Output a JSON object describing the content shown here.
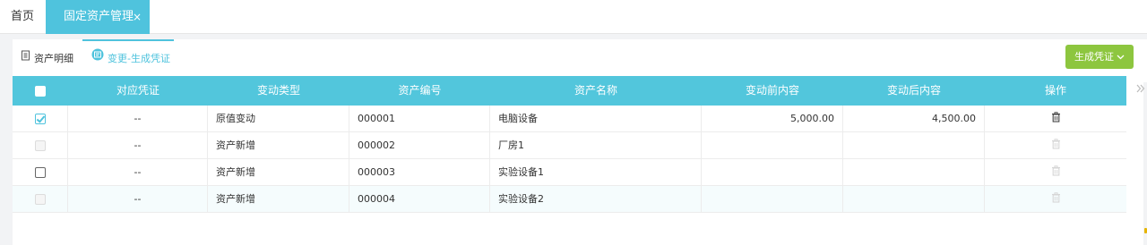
{
  "top_tabs": {
    "home": "首页",
    "asset_management": "固定资产管理",
    "close_symbol": "×"
  },
  "sub_tabs": {
    "asset_detail": "资产明细",
    "change_voucher": "变更-生成凭证"
  },
  "generate_button": {
    "label": "生成凭证"
  },
  "table": {
    "columns": [
      "对应凭证",
      "变动类型",
      "资产编号",
      "资产名称",
      "变动前内容",
      "变动后内容",
      "操作"
    ],
    "rows": [
      {
        "checkbox": "checked",
        "voucher": "--",
        "change_type": "原值变动",
        "asset_no": "000001",
        "asset_name": "电脑设备",
        "before": "5,000.00",
        "after": "4,500.00",
        "delete_enabled": true
      },
      {
        "checkbox": "disabled",
        "voucher": "--",
        "change_type": "资产新增",
        "asset_no": "000002",
        "asset_name": "厂房1",
        "before": "",
        "after": "",
        "delete_enabled": false
      },
      {
        "checkbox": "unchecked",
        "voucher": "--",
        "change_type": "资产新增",
        "asset_no": "000003",
        "asset_name": "实验设备1",
        "before": "",
        "after": "",
        "delete_enabled": false
      },
      {
        "checkbox": "disabled",
        "voucher": "--",
        "change_type": "资产新增",
        "asset_no": "000004",
        "asset_name": "实验设备2",
        "before": "",
        "after": "",
        "delete_enabled": false
      }
    ]
  },
  "colors": {
    "accent": "#4fc3dd",
    "header_bg": "#52c6dc",
    "button_green": "#8dc63f"
  },
  "icons": {
    "asset_detail": "document-icon",
    "change_voucher": "voucher-icon",
    "delete": "trash-icon",
    "collapse": "double-chevron-right-icon"
  }
}
